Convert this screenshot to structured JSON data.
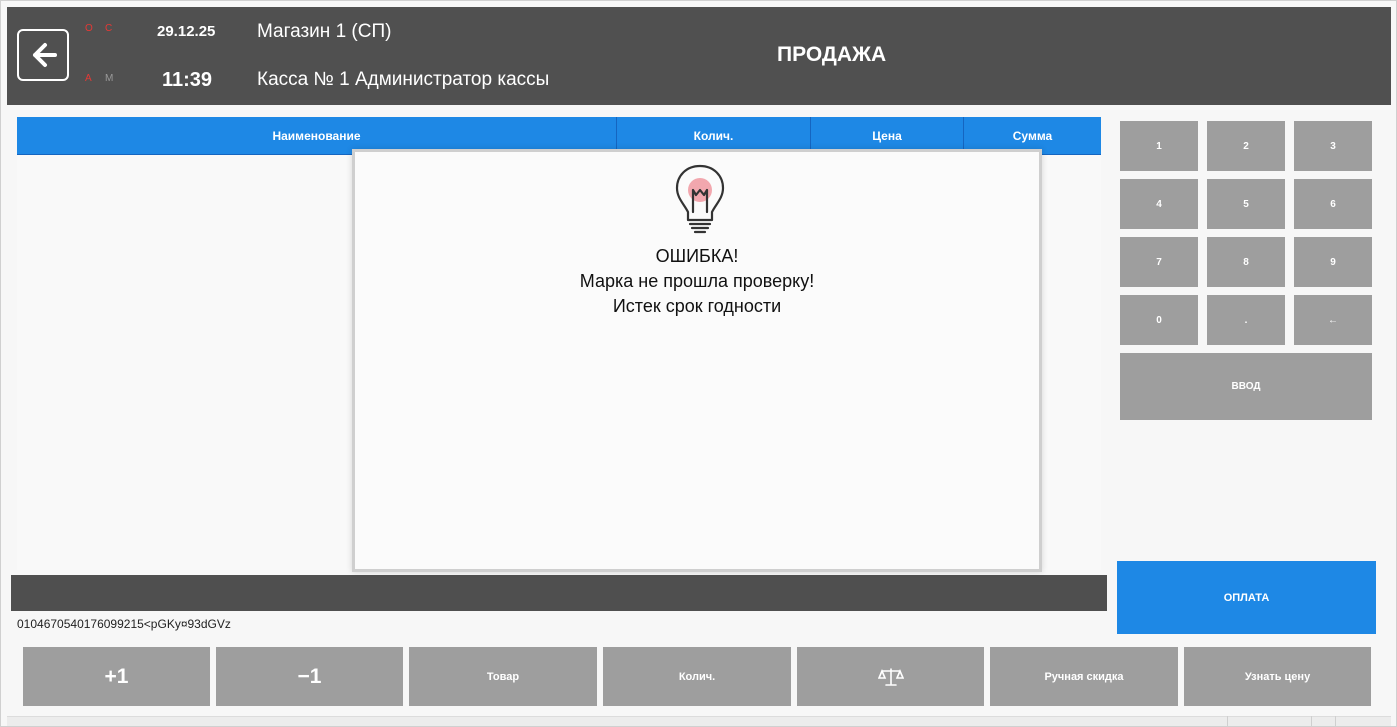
{
  "header": {
    "indicators": [
      "О",
      "С",
      "А",
      "М"
    ],
    "date": "29.12.25",
    "time": "11:39",
    "store": "Магазин 1 (СП)",
    "register": "Касса № 1 Администратор кассы",
    "title": "ПРОДАЖА"
  },
  "table": {
    "columns": [
      "Наименование",
      "Колич.",
      "Цена",
      "Сумма"
    ],
    "rows": []
  },
  "dialog": {
    "icon": "lightbulb-icon",
    "heading": "ОШИБКА!",
    "line1": "Марка не прошла проверку!",
    "line2": "Истек срок годности"
  },
  "barcode": "0104670540176099215<pGKy¤93dGVz",
  "keypad": {
    "keys": [
      "1",
      "2",
      "3",
      "4",
      "5",
      "6",
      "7",
      "8",
      "9",
      "0",
      ".",
      "←"
    ],
    "enter": "ВВОД"
  },
  "payment": {
    "label": "ОПЛАТА"
  },
  "bottom_buttons": [
    "+1",
    "−1",
    "Товар",
    "Колич.",
    "scales-icon",
    "Ручная скидка",
    "Узнать цену"
  ],
  "colors": {
    "header_bg": "#505050",
    "accent_blue": "#1e88e5",
    "button_gray": "#9e9e9e",
    "indicator_red": "#e53935"
  }
}
